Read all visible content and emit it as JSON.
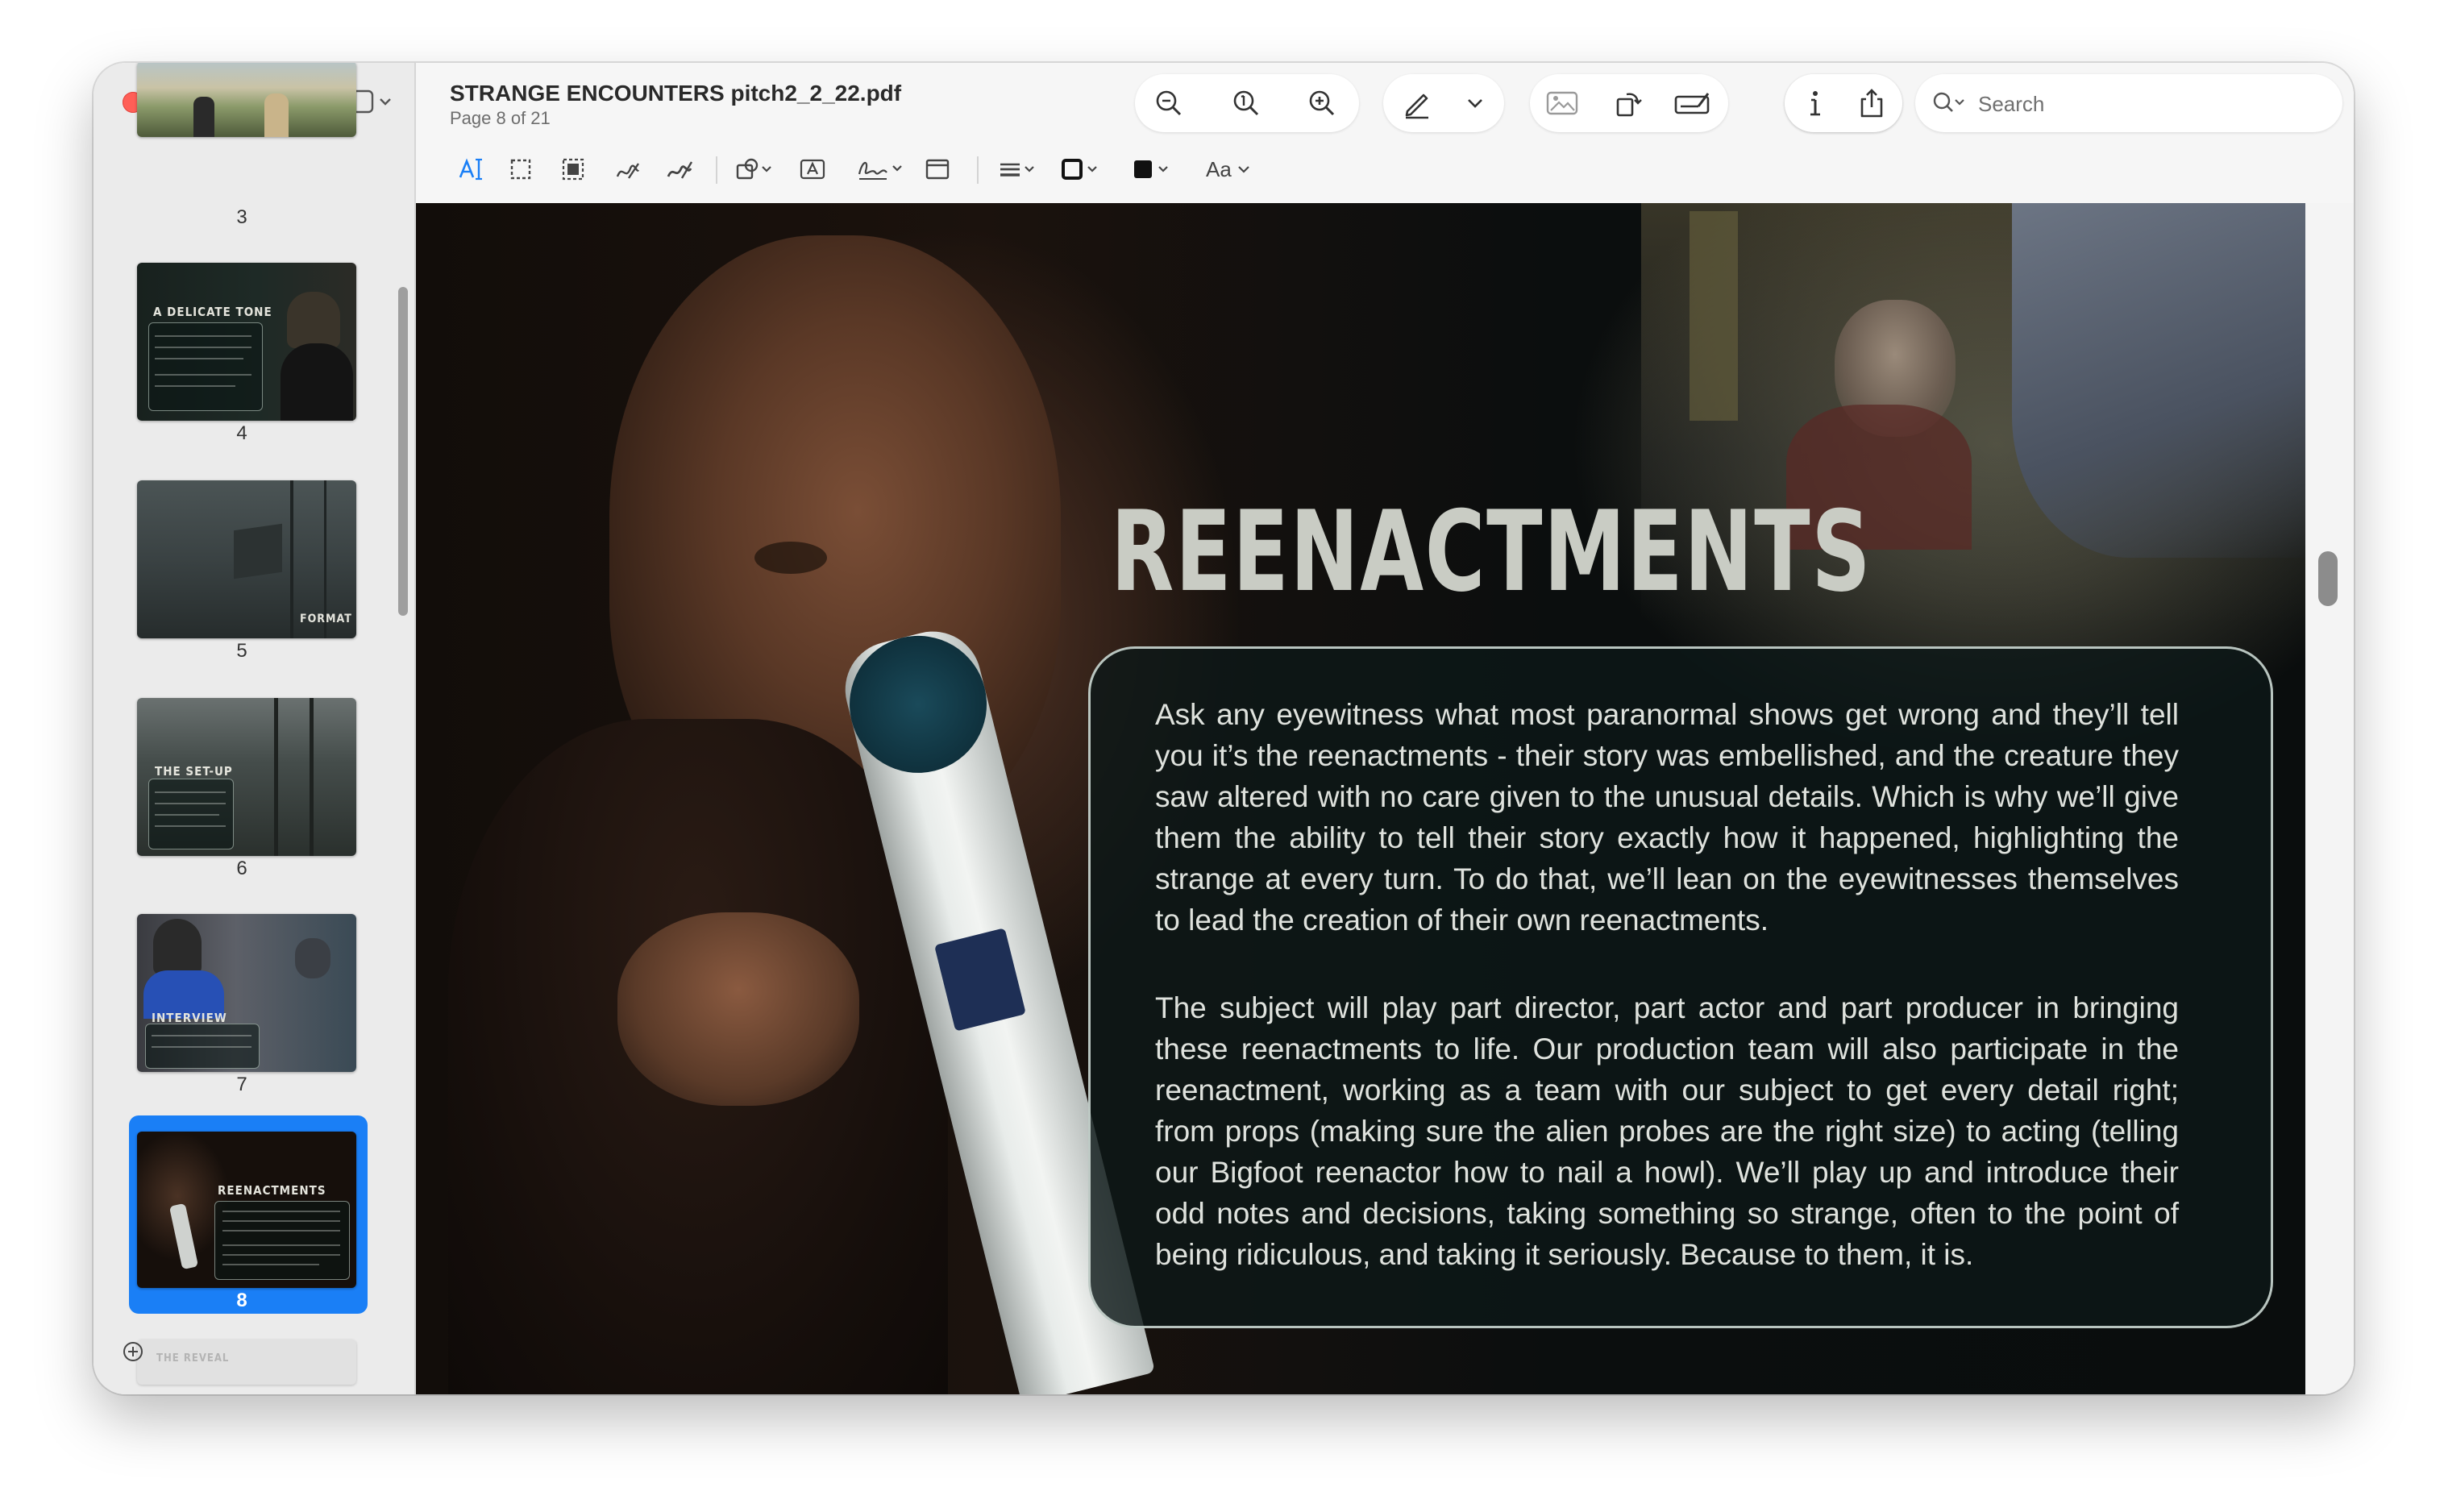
{
  "window": {
    "document_title": "STRANGE ENCOUNTERS pitch2_2_22.pdf",
    "page_indicator": "Page 8 of 21"
  },
  "toolbar": {
    "icons": [
      "zoom-out-icon",
      "zoom-fit-icon",
      "zoom-in-icon",
      "highlight-pen-icon",
      "chevron-down-icon",
      "image-icon",
      "rotate-icon",
      "annotate-icon",
      "markup-icon",
      "info-icon",
      "share-icon"
    ],
    "search_placeholder": "Search",
    "markup_tools": [
      "text-selection-icon",
      "rectangle-select-icon",
      "redact-icon",
      "sketch-icon",
      "draw-icon",
      "shapes-icon",
      "text-box-icon",
      "signature-icon",
      "note-icon",
      "line-style-icon",
      "border-color-icon",
      "fill-color-icon",
      "text-style-icon"
    ],
    "text_style_label": "Aa",
    "accent_color": "#1a7ff6"
  },
  "sidebar": {
    "thumbnails": [
      {
        "page": "3"
      },
      {
        "page": "4",
        "tag": "A DELICATE TONE"
      },
      {
        "page": "5",
        "tag": "FORMAT"
      },
      {
        "page": "6",
        "tag": "THE SET-UP"
      },
      {
        "page": "7",
        "tag": "INTERVIEW"
      },
      {
        "page": "8",
        "tag": "REENACTMENTS",
        "selected": true
      }
    ],
    "next_thumbnail_tag": "THE REVEAL"
  },
  "page": {
    "headline": "REENACTMENTS",
    "paragraph_1": "Ask any eyewitness what most paranormal shows get wrong and they’ll tell you it’s the reenactments - their story was embellished, and the creature they saw al­tered with no care given to the unusual details. Which is why we’ll give them the ability to tell their story exactly how it happened, highlighting the strange at every turn. To do that, we’ll lean on the eyewitnesses themselves to lead the cre­ation of their own reenactments.",
    "paragraph_2": "The subject will play part director, part actor and part producer in bringing these reenactments to life. Our production team will also participate in the reenact­ment, working as a team with our subject to get every detail right; from props (making sure the alien probes are the right size) to acting (telling our Bigfoot re­enactor how to nail a howl). We’ll play up and introduce their odd notes and de­cisions, taking something so strange, often to the point of being ridiculous, and taking it seriously. Because to them, it is."
  }
}
